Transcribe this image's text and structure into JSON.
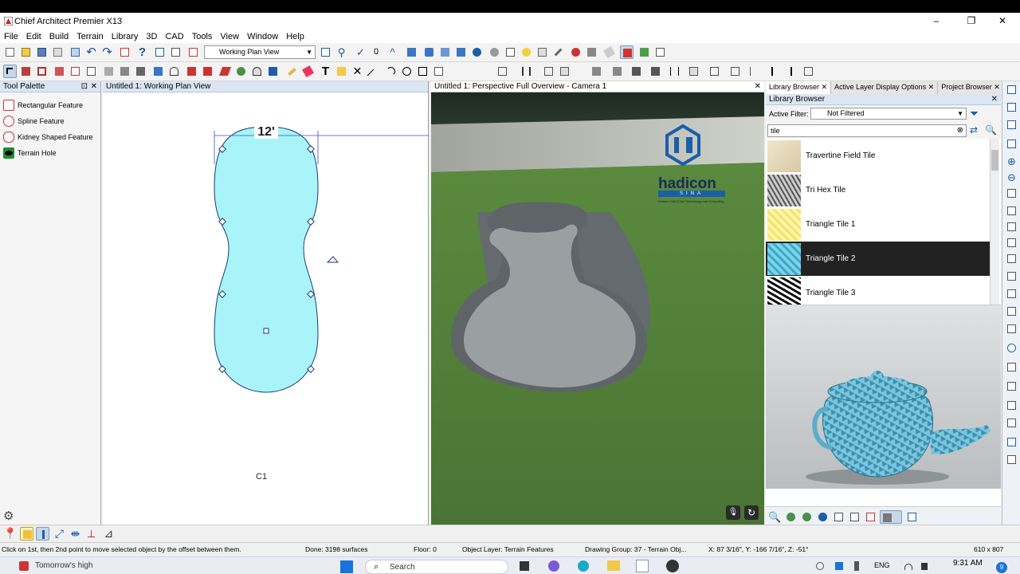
{
  "window": {
    "title": "Chief Architect Premier X13",
    "controls": [
      "–",
      "❐",
      "✕"
    ]
  },
  "menu": [
    "File",
    "Edit",
    "Build",
    "Terrain",
    "Library",
    "3D",
    "CAD",
    "Tools",
    "View",
    "Window",
    "Help"
  ],
  "toolbar": {
    "counter": "0",
    "view_select": "Working Plan View"
  },
  "tool_palette": {
    "title": "Tool Palette",
    "items": [
      "Rectangular Feature",
      "Spline Feature",
      "Kidney Shaped Feature",
      "Terrain Hole"
    ]
  },
  "plan_view": {
    "title": "Untitled 1:  Working Plan View",
    "dimension": "12'",
    "camera_label": "C1"
  },
  "perspective_view": {
    "title": "Untitled 1: Perspective Full Overview - Camera 1",
    "watermark_brand": "hadicon",
    "watermark_sub": "SINA",
    "watermark_tagline": "Vietnam CAD/CAM Technology and Consulting"
  },
  "library": {
    "tabs": [
      "Library Browser",
      "Active Layer Display Options",
      "Project Browser"
    ],
    "header": "Library Browser",
    "filter_label": "Active Filter:",
    "filter_value": "Not Filtered",
    "search_value": "tile",
    "items": [
      {
        "name": "Travertine Field Tile",
        "selected": false
      },
      {
        "name": "Tri Hex Tile",
        "selected": false
      },
      {
        "name": "Triangle Tile 1",
        "selected": false
      },
      {
        "name": "Triangle Tile 2",
        "selected": true
      },
      {
        "name": "Triangle Tile 3",
        "selected": false
      }
    ]
  },
  "status": {
    "hint": "Click on 1st, then 2nd point to move selected object by the offset between them.",
    "done": "Done:  3198 surfaces",
    "floor": "Floor: 0",
    "layer": "Object Layer: Terrain Features",
    "group": "Drawing Group: 37 - Terrain Obj...",
    "coords": "X: 87 3/16\", Y: -166 7/16\", Z: -51°",
    "size": "610 x 807"
  },
  "taskbar": {
    "weather": "Tomorrow's high",
    "search": "Search",
    "lang": "ENG",
    "time": "9:31 AM",
    "badge": "9"
  },
  "colors": {
    "accent_blue": "#1a5ea8",
    "pool_fill": "#a8f4f8",
    "grass": "#4e7a3a",
    "selected_row": "#222222"
  }
}
